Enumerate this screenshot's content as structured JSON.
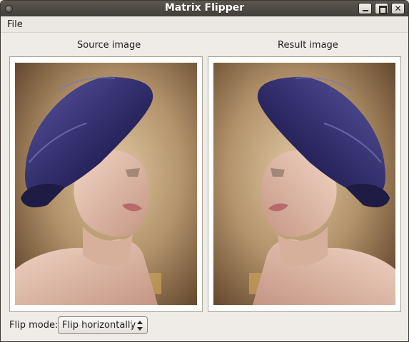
{
  "window": {
    "title": "Matrix Flipper"
  },
  "menu": {
    "file": "File"
  },
  "panels": {
    "source_caption": "Source image",
    "result_caption": "Result image"
  },
  "controls": {
    "flip_mode_label": "Flip mode:",
    "flip_mode_value": "Flip horizontally"
  },
  "icons": {
    "window_menu": "window-menu-icon",
    "minimize": "minimize-icon",
    "maximize": "maximize-icon",
    "close": "close-icon",
    "combo": "up-down-arrows-icon"
  },
  "colors": {
    "titlebar": "#4a4640",
    "window_bg": "#efebe7",
    "hat": "#2e2a5e"
  }
}
